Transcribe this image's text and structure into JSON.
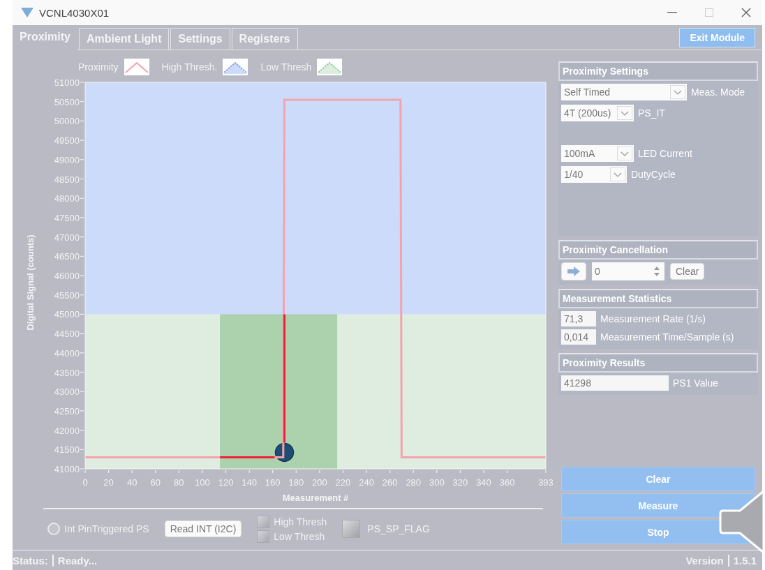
{
  "window": {
    "title": "VCNL4030X01"
  },
  "tabs": [
    {
      "label": "Proximity",
      "selected": true
    },
    {
      "label": "Ambient Light",
      "selected": false
    },
    {
      "label": "Settings",
      "selected": false
    },
    {
      "label": "Registers",
      "selected": false
    }
  ],
  "exit_button": "Exit Module",
  "chart": {
    "chart_data": {
      "type": "line",
      "xlabel": "Measurement #",
      "ylabel": "Digital Signal  (counts)",
      "x": [
        0,
        169,
        170,
        269,
        270,
        393
      ],
      "series": [
        {
          "name": "Proximity",
          "color": "#f4a3ad",
          "values": [
            41300,
            41300,
            50550,
            50550,
            41300,
            41300
          ]
        }
      ],
      "xlim": [
        0,
        393
      ],
      "ylim": [
        41000,
        51000
      ],
      "xticks": [
        0,
        20,
        40,
        60,
        80,
        100,
        120,
        140,
        160,
        180,
        200,
        220,
        240,
        260,
        280,
        300,
        320,
        340,
        360,
        393
      ],
      "yticks": [
        41000,
        41500,
        42000,
        42500,
        43000,
        43500,
        44000,
        44500,
        45000,
        45500,
        46000,
        46500,
        47000,
        47500,
        48000,
        48500,
        49000,
        49500,
        50000,
        50500,
        51000
      ],
      "bands": [
        {
          "axis": "y",
          "from": 41000,
          "to": 45000,
          "color": "#dfece0"
        },
        {
          "axis": "x",
          "from": 115,
          "to": 215,
          "color": "#abd1ad"
        },
        {
          "axis": "y",
          "from": 45000,
          "to": 51000,
          "color": "#cddbfa"
        }
      ]
    },
    "threshold_legend": [
      {
        "label": "High Thresh.",
        "color": "#cddbfa"
      },
      {
        "label": "Low Thresh",
        "color": "#dfece0"
      }
    ]
  },
  "bottom_controls": {
    "int_pin": {
      "label": "Int PinTriggered PS",
      "selected": false
    },
    "read_button": "Read INT (I2C)",
    "flags": [
      {
        "label": "High Thresh",
        "checked": false
      },
      {
        "label": "Low Thresh",
        "checked": false
      }
    ],
    "sp_flag": {
      "label": "PS_SP_FLAG",
      "on": false
    }
  },
  "proximity_settings": {
    "title": "Proximity Settings",
    "groups": [
      [
        {
          "value": "Self Timed",
          "label": "Meas. Mode",
          "kind": "wide"
        },
        {
          "value": "4T (200us)",
          "label": "PS_IT",
          "kind": "medium"
        }
      ],
      [
        {
          "value": "100mA",
          "label": "LED Current",
          "kind": "medium"
        },
        {
          "value": "1/40",
          "label": "DutyCycle",
          "kind": "narrow"
        }
      ]
    ]
  },
  "proximity_cancellation": {
    "title": "Proximity Cancellation",
    "value": "0",
    "button": "Clear"
  },
  "measurement_statistics": {
    "title": "Measurement Statistics",
    "readouts": [
      {
        "value": "71,3",
        "label": "Measurement Rate (1/s)"
      },
      {
        "value": "0,014",
        "label": "Measurement Time/Sample (s)"
      }
    ]
  },
  "proximity_results": {
    "title": "Proximity Results",
    "readouts": [
      {
        "value": "41298",
        "label": "PS1 Value"
      }
    ]
  },
  "actions": [
    "Clear",
    "Measure",
    "Stop"
  ],
  "status_bar": {
    "label": "Status:",
    "text": "Ready...",
    "version_label": "Version",
    "version": "1.5.1"
  }
}
